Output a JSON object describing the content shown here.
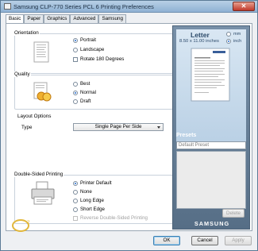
{
  "window": {
    "title": "Samsung CLP-770 Series PCL 6 Printing Preferences",
    "close_glyph": "✕"
  },
  "tabs": [
    {
      "label": "Basic",
      "active": true
    },
    {
      "label": "Paper"
    },
    {
      "label": "Graphics"
    },
    {
      "label": "Advanced"
    },
    {
      "label": "Samsung"
    }
  ],
  "orientation": {
    "title": "Orientation",
    "portrait": "Portrait",
    "landscape": "Landscape",
    "rotate": "Rotate 180 Degrees",
    "selected": "portrait"
  },
  "quality": {
    "title": "Quality",
    "best": "Best",
    "normal": "Normal",
    "draft": "Draft",
    "selected": "normal"
  },
  "layout": {
    "title": "Layout Options",
    "type_label": "Type",
    "type_value": "Single Page Per Side"
  },
  "duplex": {
    "title": "Double-Sided Printing",
    "printer_default": "Printer Default",
    "none": "None",
    "long_edge": "Long Edge",
    "short_edge": "Short Edge",
    "reverse": "Reverse Double-Sided Printing",
    "selected": "printer_default"
  },
  "side_panel": {
    "paper_name": "Letter",
    "paper_size": "8.50 x 11.00 inches",
    "unit_mm": "mm",
    "unit_inch": "inch",
    "unit_selected": "inch",
    "presets_title": "Presets",
    "preset_value": "Default Preset",
    "delete_label": "Delete",
    "brand": "SAMSUNG"
  },
  "footer": {
    "ok": "OK",
    "cancel": "Cancel",
    "apply": "Apply"
  },
  "colors": {
    "title_text": "#1c2e42",
    "side_panel": "#667e96",
    "accent": "#2a6fd0"
  }
}
